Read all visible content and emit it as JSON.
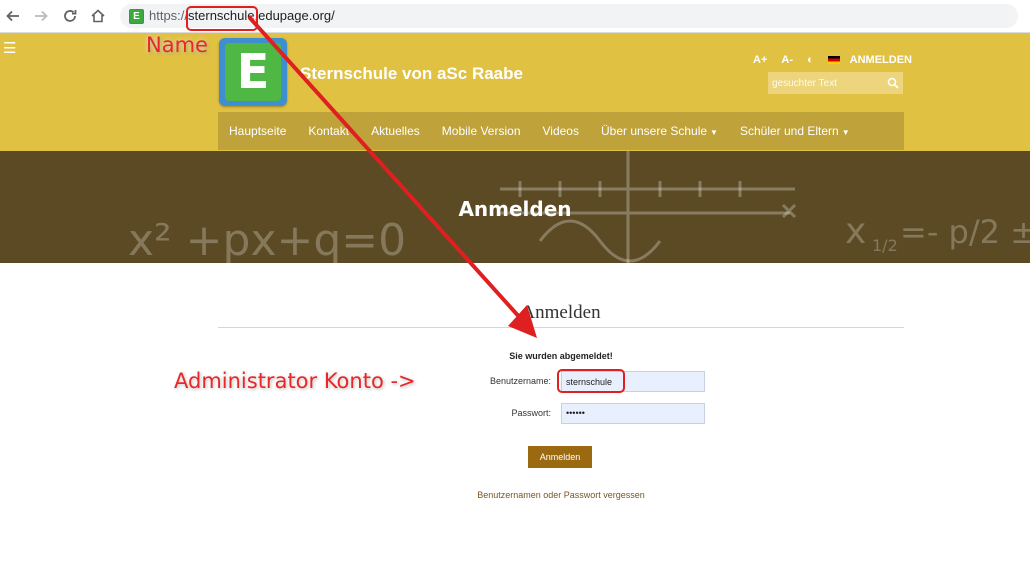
{
  "browser": {
    "url_scheme": "https://",
    "url_host": "sternschule.edupage.org/",
    "favicon_letter": "E"
  },
  "header": {
    "logo_letter": "E",
    "school_name": "Sternschule von aSc Raabe",
    "tools": {
      "font_larger": "A+",
      "font_smaller": "A-",
      "contrast": "◐",
      "login": "ANMELDEN"
    },
    "search_placeholder": "gesuchter Text"
  },
  "menu": [
    {
      "label": "Hauptseite",
      "dropdown": false
    },
    {
      "label": "Kontakt",
      "dropdown": false
    },
    {
      "label": "Aktuelles",
      "dropdown": false
    },
    {
      "label": "Mobile Version",
      "dropdown": false
    },
    {
      "label": "Videos",
      "dropdown": false
    },
    {
      "label": "Über unsere Schule",
      "dropdown": true
    },
    {
      "label": "Schüler und Eltern",
      "dropdown": true
    }
  ],
  "banner": {
    "title": "Anmelden"
  },
  "login": {
    "title": "Anmelden",
    "notice": "Sie wurden abgemeldet!",
    "username_label": "Benutzername:",
    "username_value": "sternschule",
    "password_label": "Passwort:",
    "password_value": "••••••",
    "submit_label": "Anmelden",
    "forgot_link": "Benutzernamen oder Passwort vergessen"
  },
  "annotations": {
    "name_label": "Name",
    "admin_label": "Administrator Konto ->"
  },
  "colors": {
    "header_bg": "#e0c142",
    "menu_bg": "#bfa23a",
    "button_bg": "#9b6a10",
    "annotation_red": "#e02020"
  }
}
